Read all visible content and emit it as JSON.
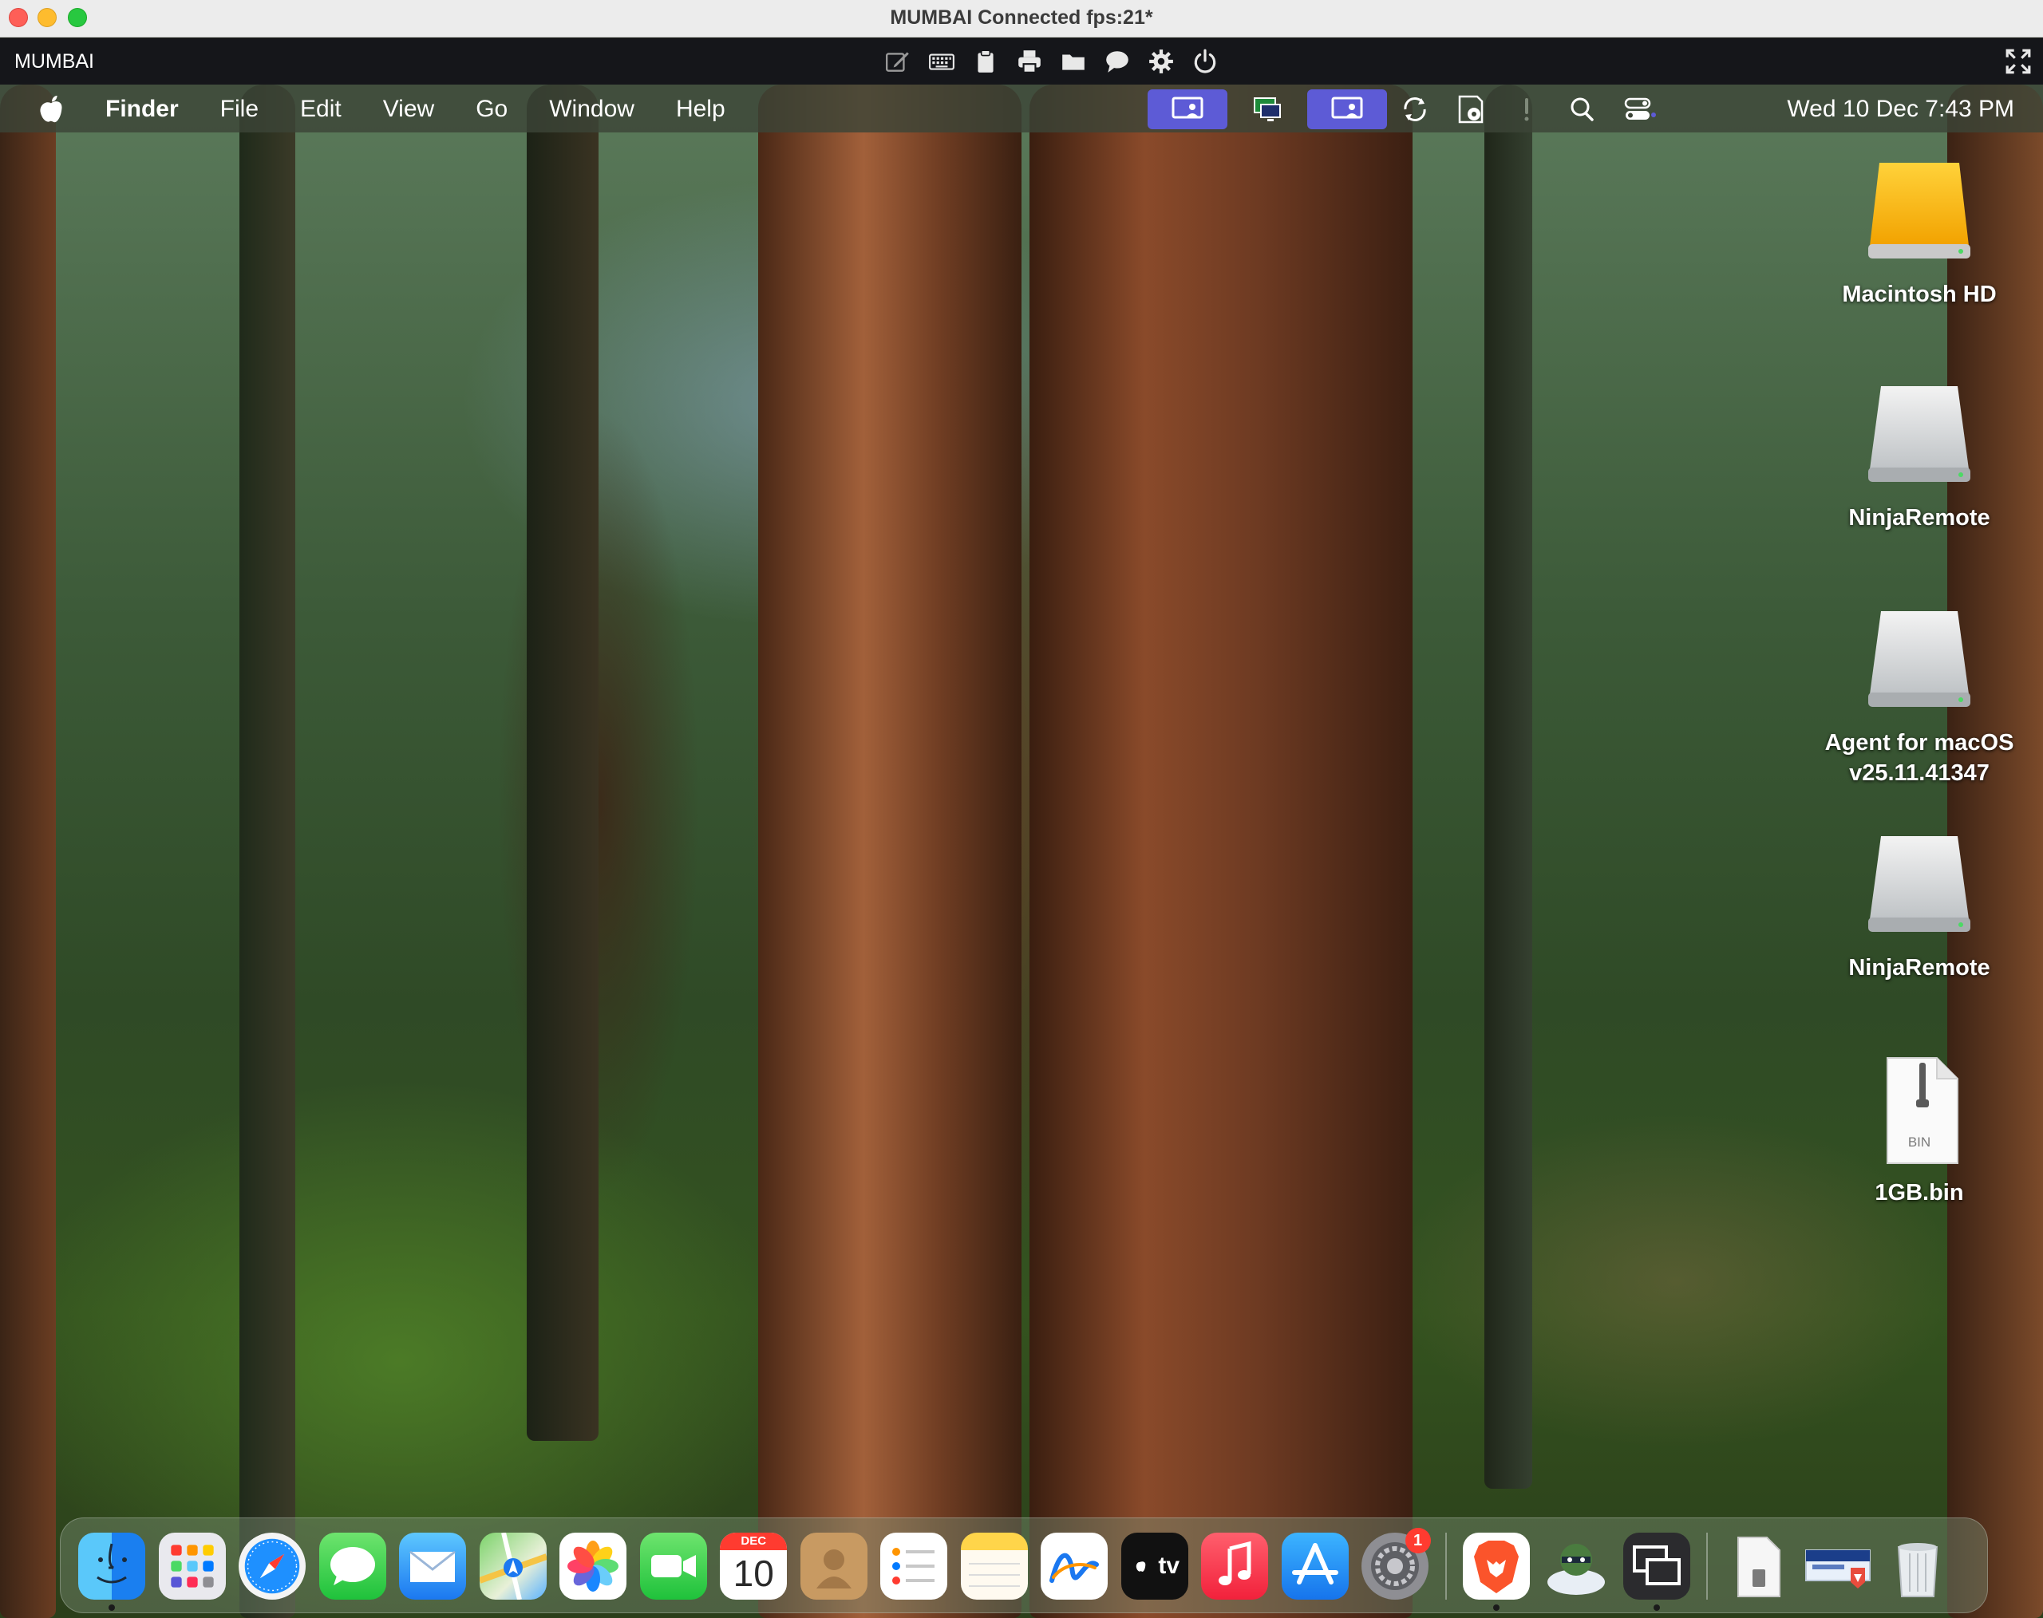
{
  "window": {
    "title": "MUMBAI Connected fps:21*"
  },
  "remote_toolbar": {
    "host_label": "MUMBAI",
    "tools": [
      "edit-icon",
      "keyboard-icon",
      "clipboard-icon",
      "printer-icon",
      "folder-icon",
      "chat-icon",
      "gear-icon",
      "power-icon"
    ],
    "fullscreen": "fullscreen-icon"
  },
  "menubar": {
    "app_name": "Finder",
    "menus": [
      "File",
      "Edit",
      "View",
      "Go",
      "Window",
      "Help"
    ],
    "clock": "Wed 10 Dec  7:43 PM"
  },
  "desktop_icons": [
    {
      "label": "Macintosh HD",
      "kind": "internal-drive"
    },
    {
      "label": "NinjaRemote",
      "kind": "external-drive"
    },
    {
      "label": "Agent for macOS v25.11.41347",
      "kind": "external-drive"
    },
    {
      "label": "NinjaRemote",
      "kind": "external-drive"
    },
    {
      "label": "1GB.bin",
      "kind": "bin-file",
      "badge_text": "BIN"
    }
  ],
  "dock": {
    "calendar_month": "DEC",
    "calendar_day": "10",
    "appletv_text": "tv",
    "settings_badge": "1"
  },
  "colors": {
    "menubar_selected": "#5d5bd6",
    "close": "#fe5f57",
    "minimize": "#febc2e",
    "maximize": "#28c840"
  }
}
